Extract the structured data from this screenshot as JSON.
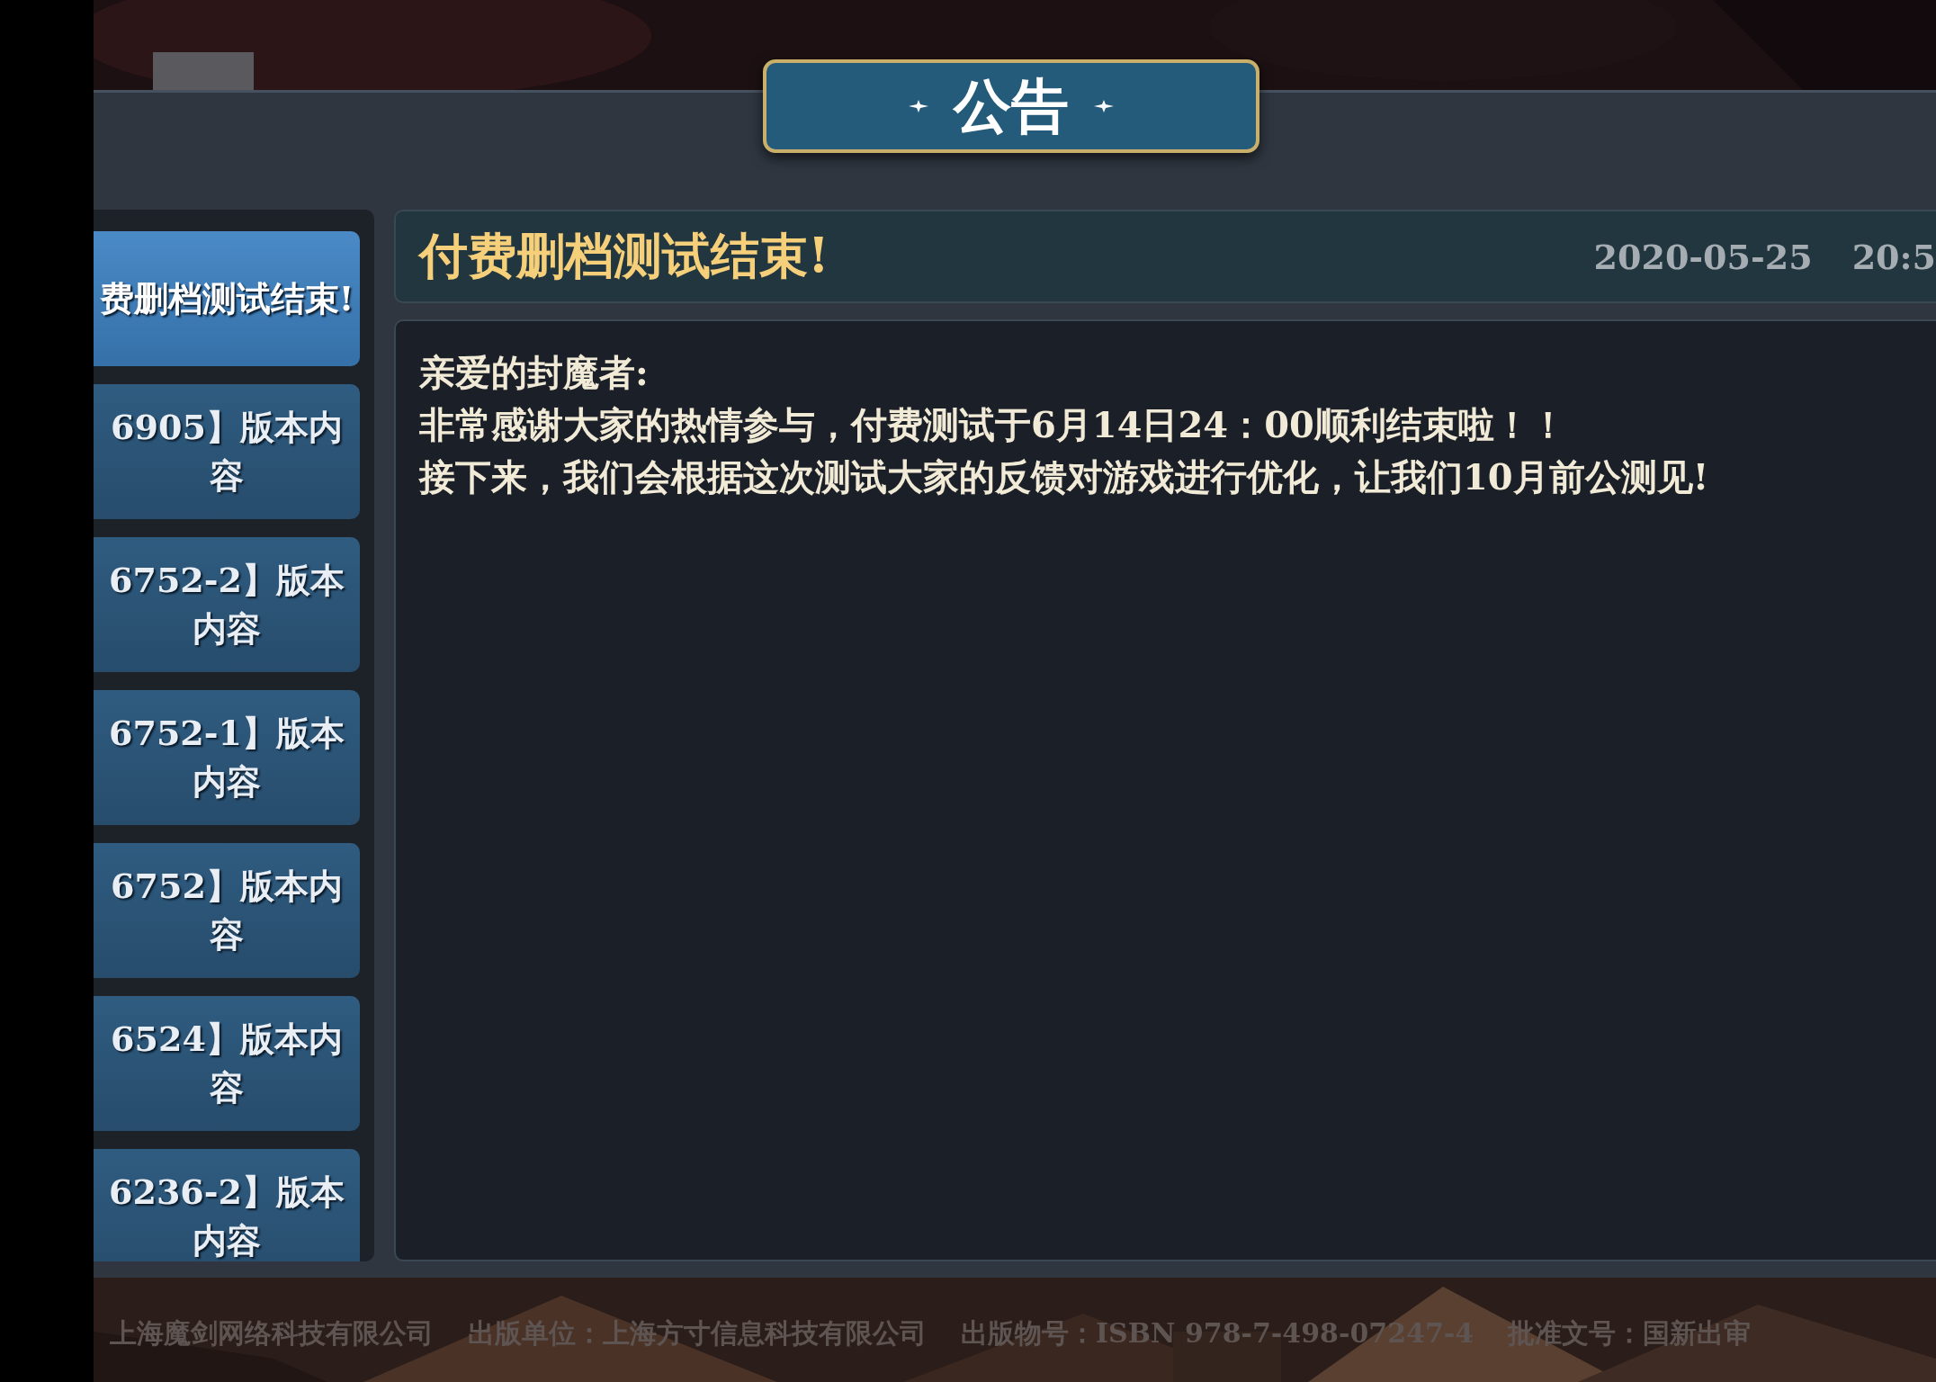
{
  "title": "公告",
  "sidebar": {
    "items": [
      {
        "label": "费删档测试结束!",
        "selected": true
      },
      {
        "label": "6905】版本内容",
        "selected": false
      },
      {
        "label": "6752-2】版本内容",
        "selected": false
      },
      {
        "label": "6752-1】版本内容",
        "selected": false
      },
      {
        "label": "6752】版本内容",
        "selected": false
      },
      {
        "label": "6524】版本内容",
        "selected": false
      },
      {
        "label": "6236-2】版本内容",
        "selected": false
      }
    ]
  },
  "article": {
    "title": "付费删档测试结束!",
    "date": "2020-05-25",
    "time": "20:5",
    "paragraphs": [
      "亲爱的封魔者:",
      "非常感谢大家的热情参与，付费测试于6月14日24：00顺利结束啦！！",
      "接下来，我们会根据这次测试大家的反馈对游戏进行优化，让我们10月前公测见!"
    ]
  },
  "footer": [
    "上海魔剑网络科技有限公司",
    "出版单位：上海方寸信息科技有限公司",
    "出版物号：ISBN 978-7-498-07247-4",
    "批准文号：国新出审"
  ]
}
